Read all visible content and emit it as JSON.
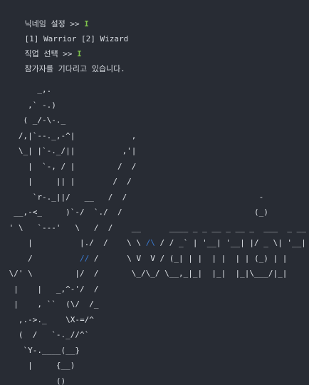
{
  "terminal": {
    "lines": [
      {
        "text": "닉네임 설정 >> ",
        "cursor": "I"
      },
      {
        "text": "[1] Warrior [2] Wizard",
        "cursor": ""
      },
      {
        "text": "직업 선택 >> ",
        "cursor": "I"
      },
      {
        "text": "참가자를 기다리고 있습니다.",
        "cursor": ""
      }
    ]
  },
  "ascii_art": {
    "lines": [
      "       _,.",
      "     ,` -.)",
      "    ( _/-\\-._",
      "   /,|`--._,-^|            ,",
      "   \\_| |`-._/||          ,'|",
      "     |  `-, / |         /  /",
      "     |     || |        /  /",
      "      `r-._||/   __   /  /                            -",
      "  __,-<_     )`-/  `./  /                            (_)",
      " ' \\   `---'   \\   /  /    __      ____ _ _ __ _ __ _  ___  _ __",
      "     |          |./  /    \\ \\ /\\ / / _` | '__| '__| |/ _ \\| '__|",
      "     /          // /      \\ V  V / (_| | |  | |  | | (_) | |",
      " \\/' \\         |/  /       \\_/\\_/ \\__,_|_|  |_|  |_|\\___/|_|",
      "  |    |   _,^-'/  /",
      "  |    , ``  (\\/  /_",
      "   ,.->._    \\X-=/^",
      "   (  /   `-._//^`",
      "    `Y-.____(__}",
      "     |     {__)",
      "           ()"
    ]
  },
  "colors": {
    "background": "#282c34",
    "text": "#d4d8de",
    "cursor": "#7ec24c",
    "accent": "#3a7bd5"
  }
}
